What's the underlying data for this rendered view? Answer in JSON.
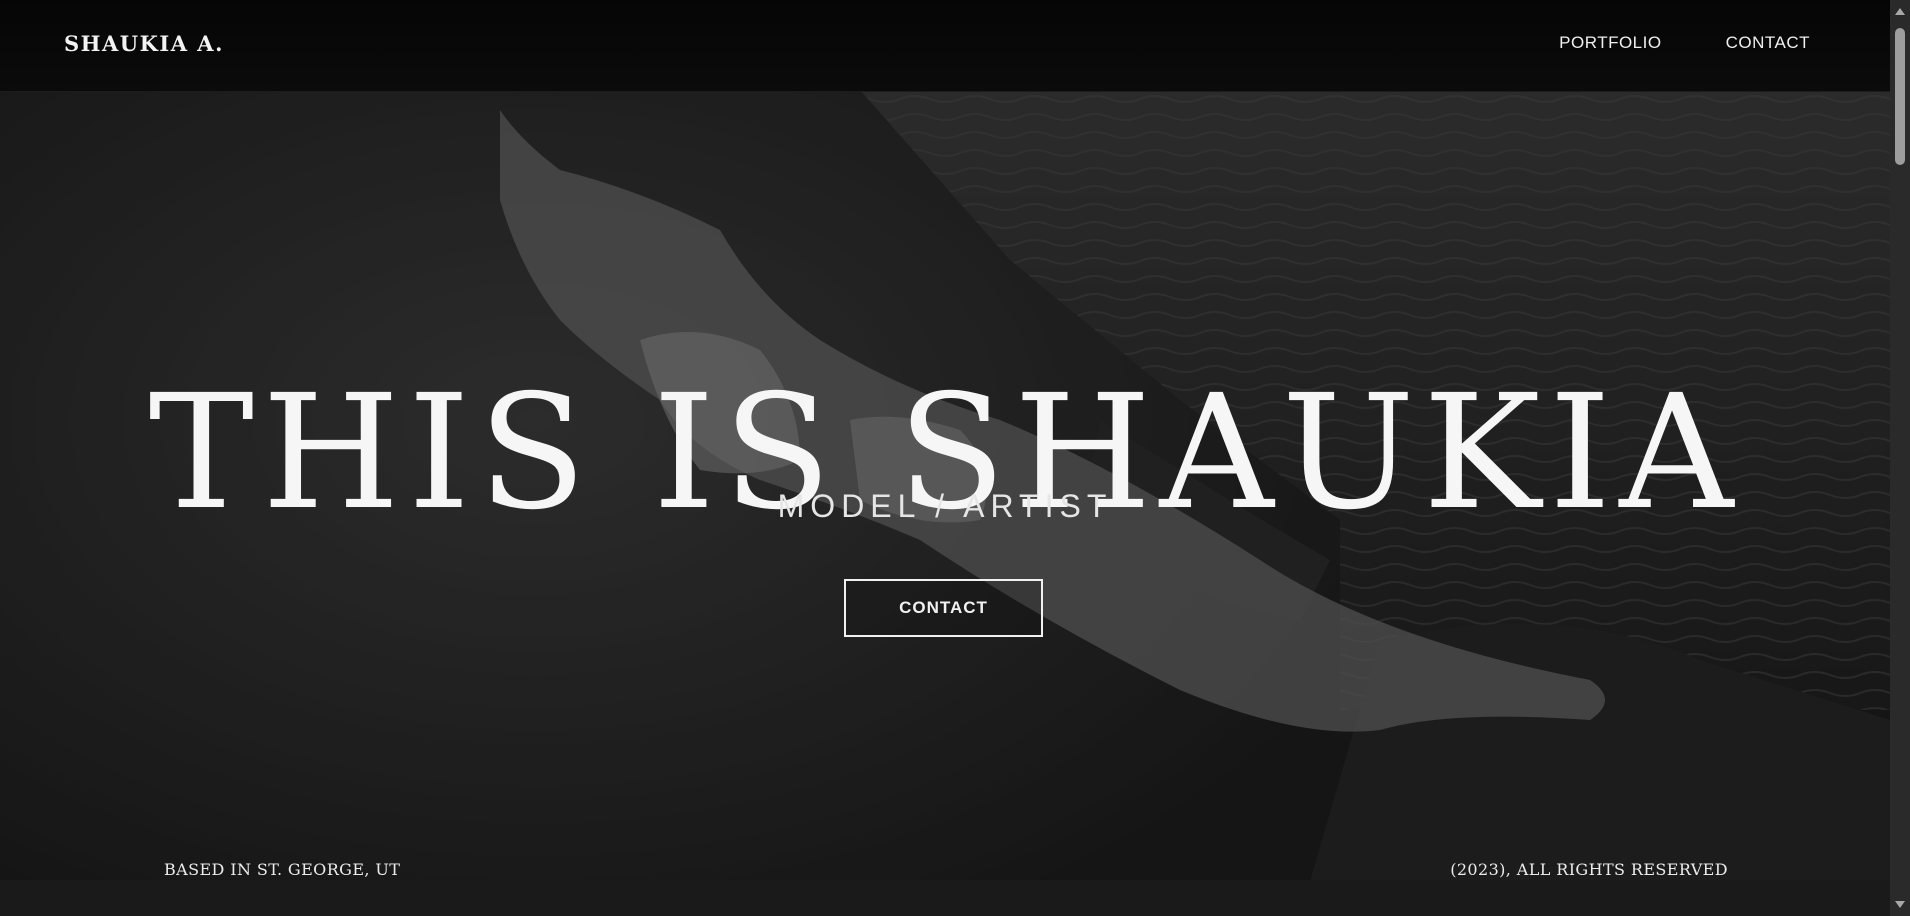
{
  "header": {
    "brand": "SHAUKIA A.",
    "nav": {
      "portfolio": "PORTFOLIO",
      "contact": "CONTACT"
    }
  },
  "hero": {
    "title": "THIS IS SHAUKIA",
    "subtitle": "MODEL / ARTIST",
    "cta_label": "CONTACT"
  },
  "footer": {
    "location": "BASED IN ST. GEORGE, UT",
    "copyright": "(2023), ALL RIGHTS RESERVED"
  },
  "colors": {
    "background": "#141414",
    "text": "#f6f6f6",
    "header": "#050505"
  }
}
